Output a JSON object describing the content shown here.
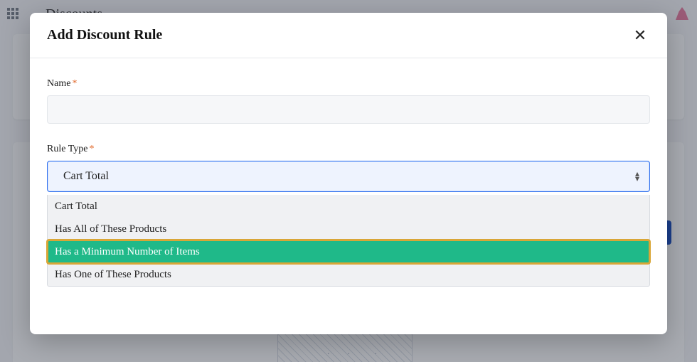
{
  "page": {
    "title": "Discounts"
  },
  "modal": {
    "title": "Add Discount Rule",
    "name_label": "Name",
    "rule_type_label": "Rule Type",
    "selected_rule": "Cart Total",
    "options": [
      "Cart Total",
      "Has All of These Products",
      "Has a Minimum Number of Items",
      "Has One of These Products"
    ],
    "highlighted_index": 2
  }
}
